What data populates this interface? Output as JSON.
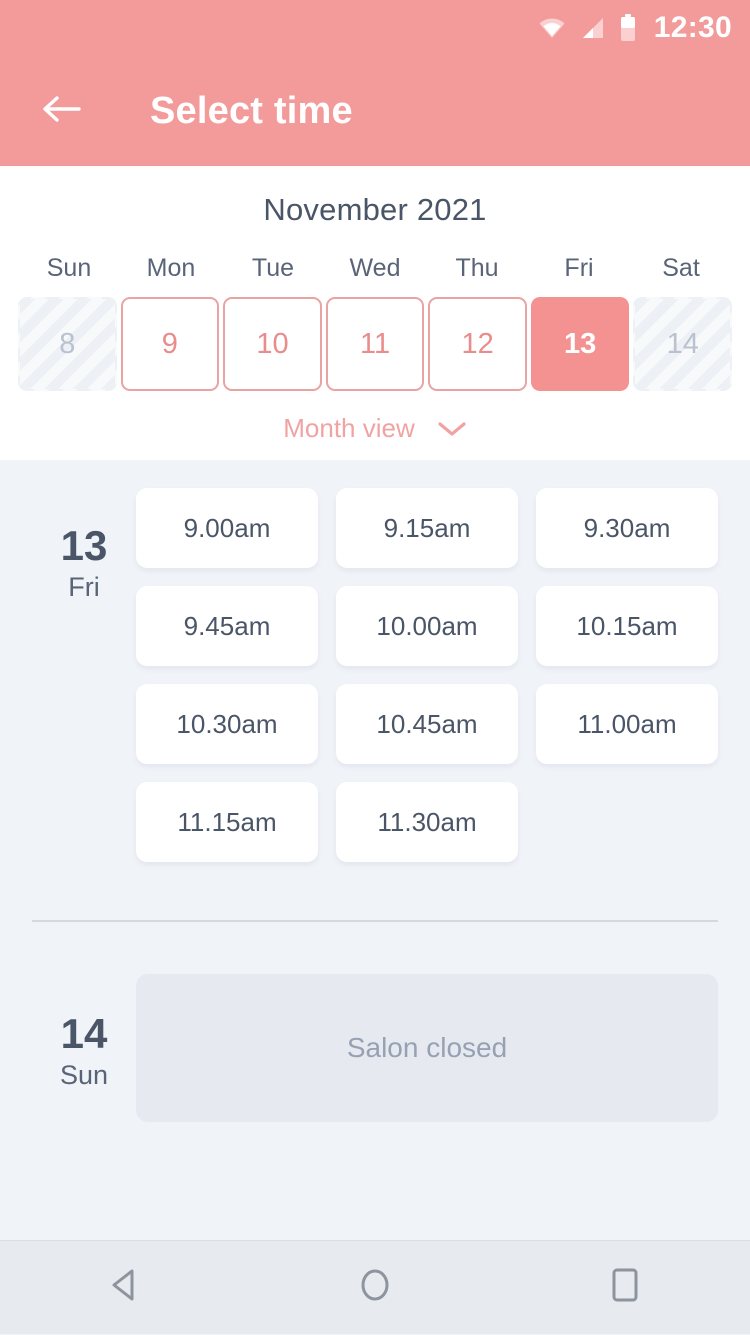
{
  "statusbar": {
    "time": "12:30",
    "icons": [
      "wifi-icon",
      "cellular-signal-icon",
      "battery-icon"
    ]
  },
  "appbar": {
    "title": "Select time",
    "back_icon": "arrow-left-icon"
  },
  "calendar": {
    "month_title": "November 2021",
    "weekdays": [
      "Sun",
      "Mon",
      "Tue",
      "Wed",
      "Thu",
      "Fri",
      "Sat"
    ],
    "dates": [
      {
        "day": "8",
        "state": "disabled"
      },
      {
        "day": "9",
        "state": "available"
      },
      {
        "day": "10",
        "state": "available"
      },
      {
        "day": "11",
        "state": "available"
      },
      {
        "day": "12",
        "state": "available"
      },
      {
        "day": "13",
        "state": "selected"
      },
      {
        "day": "14",
        "state": "disabled"
      }
    ],
    "month_view_label": "Month view",
    "month_view_icon": "chevron-down-icon"
  },
  "days": [
    {
      "day_number": "13",
      "day_of_week": "Fri",
      "slots": [
        "9.00am",
        "9.15am",
        "9.30am",
        "9.45am",
        "10.00am",
        "10.15am",
        "10.30am",
        "10.45am",
        "11.00am",
        "11.15am",
        "11.30am"
      ]
    },
    {
      "day_number": "14",
      "day_of_week": "Sun",
      "closed_label": "Salon closed"
    }
  ],
  "navbar": {
    "back_icon": "android-back-icon",
    "home_icon": "android-home-icon",
    "recents_icon": "android-recents-icon"
  },
  "colors": {
    "accent": "#F39A9A",
    "selected_date": "#F49292",
    "available_date_border": "#EAA3A3",
    "available_date_text": "#E98C8C",
    "page_background": "#F0F3F8",
    "slot_text": "#4A5568",
    "closed_card": "#E6EAF0"
  }
}
